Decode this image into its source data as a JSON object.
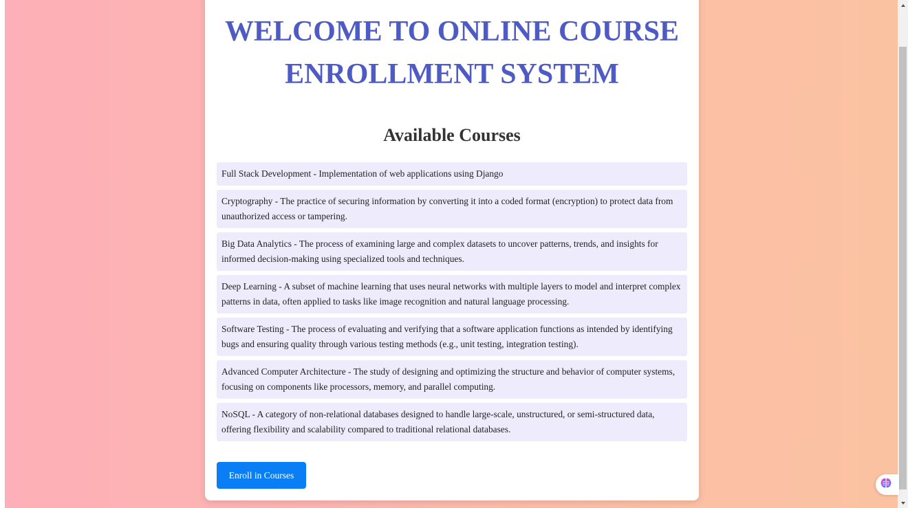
{
  "header": {
    "title": "WELCOME TO ONLINE COURSE ENROLLMENT SYSTEM"
  },
  "courses": {
    "heading": "Available Courses",
    "items": [
      "Full Stack Development - Implementation of web applications using Django",
      "Cryptography - The practice of securing information by converting it into a coded format (encryption) to protect data from unauthorized access or tampering.",
      "Big Data Analytics - The process of examining large and complex datasets to uncover patterns, trends, and insights for informed decision-making using specialized tools and techniques.",
      "Deep Learning - A subset of machine learning that uses neural networks with multiple layers to model and interpret complex patterns in data, often applied to tasks like image recognition and natural language processing.",
      "Software Testing - The process of evaluating and verifying that a software application functions as intended by identifying bugs and ensuring quality through various testing methods (e.g., unit testing, integration testing).",
      "Advanced Computer Architecture - The study of designing and optimizing the structure and behavior of computer systems, focusing on components like processors, memory, and parallel computing.",
      "NoSQL - A category of non-relational databases designed to handle large-scale, unstructured, or semi-structured data, offering flexibility and scalability compared to traditional relational databases."
    ]
  },
  "actions": {
    "enroll_label": "Enroll in Courses"
  },
  "colors": {
    "title": "#4e5bc4",
    "item_bg": "#eeecfc",
    "button": "#0a7ef5",
    "bg_left": "#fdb0b7",
    "bg_right": "#fbc2a2"
  },
  "icons": {
    "assistant": "brain-icon"
  }
}
